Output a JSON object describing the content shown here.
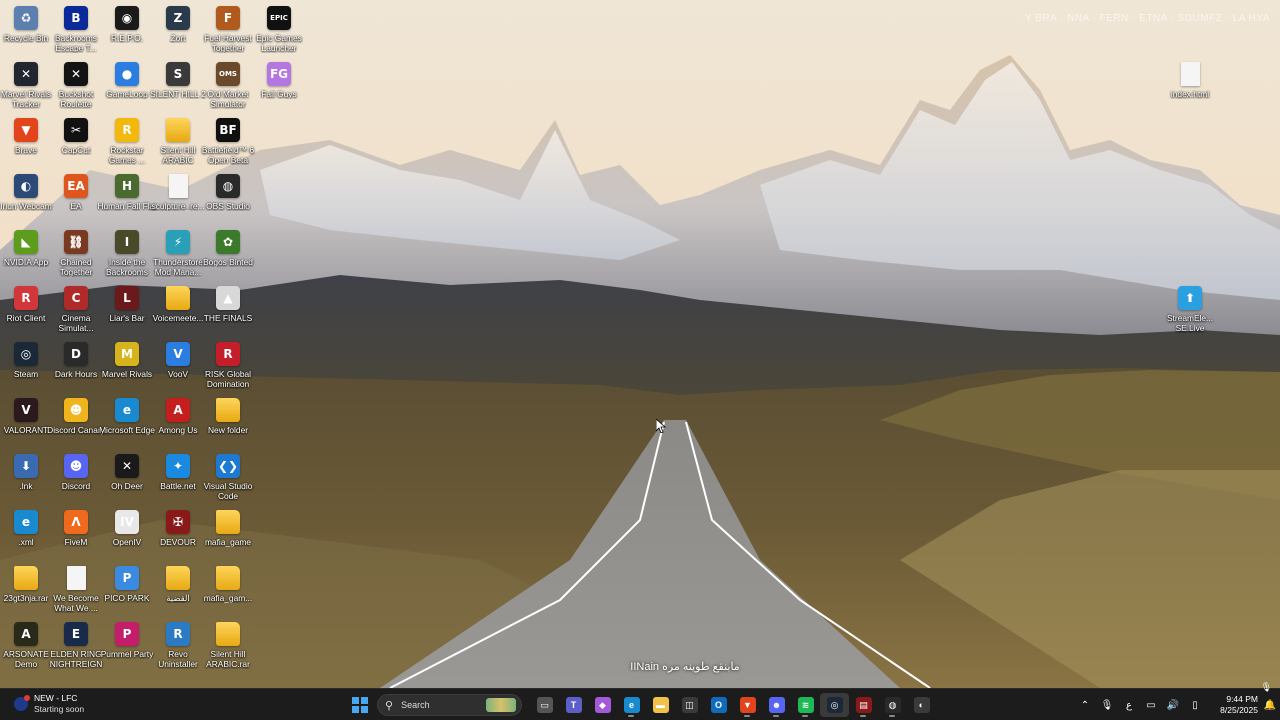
{
  "desktop": {
    "watermark": "Y BRA · NNA · FERN · ETNA · SDUMFZ · LA HYA",
    "icons": [
      {
        "label": "Recycle Bin",
        "glyph": "♻",
        "color": "#5d7fb0"
      },
      {
        "label": "Backrooms Escape T...",
        "glyph": "B",
        "color": "#0a2a9a"
      },
      {
        "label": "R.E.P.O.",
        "glyph": "◉",
        "color": "#1a1a1a"
      },
      {
        "label": "Zort",
        "glyph": "Z",
        "color": "#2a3a4a"
      },
      {
        "label": "Fuel Harvest Together",
        "glyph": "F",
        "color": "#b05a1e"
      },
      {
        "label": "Epic Games Launcher",
        "glyph": "EPIC",
        "color": "#111111"
      },
      {
        "label": "Marvel Rivals Tracker",
        "glyph": "✕",
        "color": "#22262e"
      },
      {
        "label": "Buckshot Roulette",
        "glyph": "✕",
        "color": "#141414"
      },
      {
        "label": "GameLoop",
        "glyph": "●",
        "color": "#2b7de0"
      },
      {
        "label": "SILENT HILL 2",
        "glyph": "S",
        "color": "#3a3a3a"
      },
      {
        "label": "Old Market Simulator",
        "glyph": "OMS",
        "color": "#6b4a2c"
      },
      {
        "label": "Fall Guys",
        "glyph": "FG",
        "color": "#b476e0"
      },
      {
        "label": "Brave",
        "glyph": "▼",
        "color": "#e2451c"
      },
      {
        "label": "CapCut",
        "glyph": "✂",
        "color": "#111111"
      },
      {
        "label": "Rockstar Games ...",
        "glyph": "R",
        "color": "#f2b90c"
      },
      {
        "label": "Silent Hill ARABIC",
        "glyph": "",
        "color": "#f0c24b"
      },
      {
        "label": "Battlefield™ 6 Open Beta",
        "glyph": "BF",
        "color": "#101010"
      },
      {
        "label": "",
        "glyph": "",
        "color": "transparent"
      },
      {
        "label": "Iriun Webcam",
        "glyph": "◐",
        "color": "#2c4a76"
      },
      {
        "label": "EA",
        "glyph": "EA",
        "color": "#e0541e"
      },
      {
        "label": "Human Fall Flat",
        "glyph": "H",
        "color": "#4a6a30"
      },
      {
        "label": "sculpture_re...",
        "glyph": "",
        "color": "#f5f5f5"
      },
      {
        "label": "OBS Studio",
        "glyph": "◍",
        "color": "#2a2a2a"
      },
      {
        "label": "",
        "glyph": "",
        "color": "transparent"
      },
      {
        "label": "NVIDIA App",
        "glyph": "◣",
        "color": "#5d9c1c"
      },
      {
        "label": "Chained Together",
        "glyph": "⛓",
        "color": "#7a3a22"
      },
      {
        "label": "Inside the Backrooms",
        "glyph": "I",
        "color": "#4a4a2a"
      },
      {
        "label": "Thunderstore Mod Mana...",
        "glyph": "⚡",
        "color": "#2aa0b8"
      },
      {
        "label": "Bogos Binted",
        "glyph": "✿",
        "color": "#3a7a2a"
      },
      {
        "label": "",
        "glyph": "",
        "color": "transparent"
      },
      {
        "label": "Riot Client",
        "glyph": "R",
        "color": "#d13639"
      },
      {
        "label": "Cinema Simulat...",
        "glyph": "C",
        "color": "#b02a2a"
      },
      {
        "label": "Liar's Bar",
        "glyph": "L",
        "color": "#6a1a1a"
      },
      {
        "label": "Voicemeete...",
        "glyph": "",
        "color": "#f0c24b"
      },
      {
        "label": "THE FINALS",
        "glyph": "▲",
        "color": "#d8d8d8"
      },
      {
        "label": "",
        "glyph": "",
        "color": "transparent"
      },
      {
        "label": "Steam",
        "glyph": "◎",
        "color": "#1b2838"
      },
      {
        "label": "Dark Hours",
        "glyph": "D",
        "color": "#2a2a2a"
      },
      {
        "label": "Marvel Rivals",
        "glyph": "M",
        "color": "#d8b41c"
      },
      {
        "label": "VooV",
        "glyph": "V",
        "color": "#2b7de0"
      },
      {
        "label": "RISK Global Domination",
        "glyph": "R",
        "color": "#c41e2a"
      },
      {
        "label": "",
        "glyph": "",
        "color": "transparent"
      },
      {
        "label": "VALORANT",
        "glyph": "V",
        "color": "#2a1a1e"
      },
      {
        "label": "Discord Canary",
        "glyph": "☻",
        "color": "#f0b41c"
      },
      {
        "label": "Microsoft Edge",
        "glyph": "e",
        "color": "#1a8ad0"
      },
      {
        "label": "Among Us",
        "glyph": "A",
        "color": "#c41e1e"
      },
      {
        "label": "New folder",
        "glyph": "",
        "color": "#f0c24b"
      },
      {
        "label": "",
        "glyph": "",
        "color": "transparent"
      },
      {
        "label": ".lnk",
        "glyph": "⬇",
        "color": "#3a6ab0"
      },
      {
        "label": "Discord",
        "glyph": "☻",
        "color": "#5865f2"
      },
      {
        "label": "Oh Deer",
        "glyph": "✕",
        "color": "#1a1a1a"
      },
      {
        "label": "Battle.net",
        "glyph": "✦",
        "color": "#1a8ae0"
      },
      {
        "label": "Visual Studio Code",
        "glyph": "❮❯",
        "color": "#1e7ad0"
      },
      {
        "label": "",
        "glyph": "",
        "color": "transparent"
      },
      {
        "label": ".xml",
        "glyph": "e",
        "color": "#1a8ad0"
      },
      {
        "label": "FiveM",
        "glyph": "Λ",
        "color": "#f06a1e"
      },
      {
        "label": "OpenIV",
        "glyph": "IV",
        "color": "#e8e8e8"
      },
      {
        "label": "DEVOUR",
        "glyph": "✠",
        "color": "#8a1a1a"
      },
      {
        "label": "mafia_game",
        "glyph": "",
        "color": "#f0c24b"
      },
      {
        "label": "",
        "glyph": "",
        "color": "transparent"
      },
      {
        "label": "23gt3nja.rar",
        "glyph": "",
        "color": "#f0c24b"
      },
      {
        "label": "We Become What We ...",
        "glyph": "",
        "color": "#f5f5f5"
      },
      {
        "label": "PICO PARK",
        "glyph": "P",
        "color": "#3a8ae0"
      },
      {
        "label": "القضية",
        "glyph": "",
        "color": "#f0c24b"
      },
      {
        "label": "mafia_gam...",
        "glyph": "",
        "color": "#f0c24b"
      },
      {
        "label": "",
        "glyph": "",
        "color": "transparent"
      },
      {
        "label": "ARSONATE Demo",
        "glyph": "A",
        "color": "#2a2a1a"
      },
      {
        "label": "ELDEN RING NIGHTREIGN",
        "glyph": "E",
        "color": "#1a2a4a"
      },
      {
        "label": "Pummel Party",
        "glyph": "P",
        "color": "#c41e6a"
      },
      {
        "label": "Revo Uninstaller",
        "glyph": "R",
        "color": "#2a7ac4"
      },
      {
        "label": "Silent Hill ARABIC.rar",
        "glyph": "",
        "color": "#f0c24b"
      },
      {
        "label": "",
        "glyph": "",
        "color": "transparent"
      }
    ],
    "right_icons": [
      {
        "label": "index.html",
        "glyph": "",
        "color": "#f5f5f5"
      },
      {
        "label": "StreamEle... SE.Live",
        "glyph": "⬆",
        "color": "#2aa0e0"
      }
    ]
  },
  "subtitle": "IINain مابنقع طوينه مره",
  "taskbar": {
    "weather_title": "NEW - LFC",
    "weather_subtitle": "Starting soon",
    "search_placeholder": "Search",
    "apps": [
      {
        "name": "task-view",
        "glyph": "▭",
        "color": "#555555",
        "state": ""
      },
      {
        "name": "teams",
        "glyph": "T",
        "color": "#5b5fc7",
        "state": ""
      },
      {
        "name": "copilot",
        "glyph": "◆",
        "color": "#a35ad8",
        "state": ""
      },
      {
        "name": "edge",
        "glyph": "e",
        "color": "#1a8ad0",
        "state": "running"
      },
      {
        "name": "file-explorer",
        "glyph": "▬",
        "color": "#f0c24b",
        "state": ""
      },
      {
        "name": "microsoft-store",
        "glyph": "◫",
        "color": "#3a3a3a",
        "state": ""
      },
      {
        "name": "outlook",
        "glyph": "O",
        "color": "#0f6cbd",
        "state": ""
      },
      {
        "name": "brave",
        "glyph": "▼",
        "color": "#e2451c",
        "state": "running"
      },
      {
        "name": "discord",
        "glyph": "☻",
        "color": "#5865f2",
        "state": "running"
      },
      {
        "name": "spotify",
        "glyph": "≋",
        "color": "#1db954",
        "state": "running"
      },
      {
        "name": "steam",
        "glyph": "◎",
        "color": "#1b2838",
        "state": "active"
      },
      {
        "name": "game-app",
        "glyph": "▤",
        "color": "#8a1a1a",
        "state": "running"
      },
      {
        "name": "obs",
        "glyph": "◍",
        "color": "#2a2a2a",
        "state": "running"
      },
      {
        "name": "iriun",
        "glyph": "◐",
        "color": "#3a3a3a",
        "state": ""
      }
    ],
    "tray": {
      "language": "ع",
      "time": "9:44 PM",
      "date": "8/25/2025"
    }
  }
}
